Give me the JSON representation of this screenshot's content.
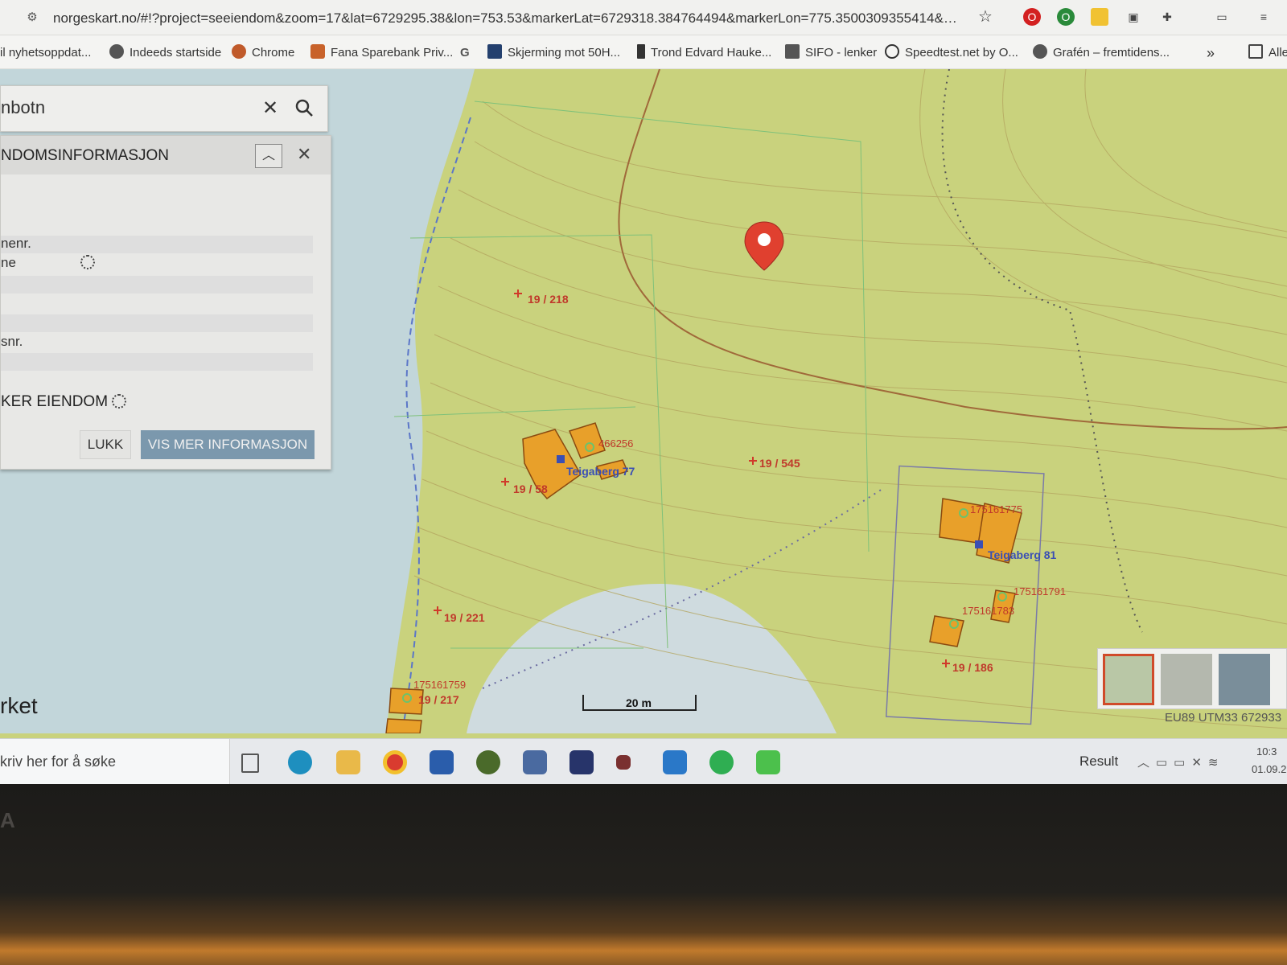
{
  "browser": {
    "url": "norgeskart.no/#!?project=seeiendom&zoom=17&lat=6729295.38&lon=753.53&markerLat=6729318.384764494&markerLon=775.3500309355414&pa...",
    "bookmarks": [
      "il nyhetsoppdat...",
      "Indeeds startside",
      "Chrome",
      "Fana Sparebank Priv...",
      "G",
      "Skjerming mot 50H...",
      "Trond Edvard Hauke...",
      "SIFO - lenker",
      "Speedtest.net by O...",
      "Grafén – fremtidens...",
      "»",
      "Alle"
    ]
  },
  "search": {
    "value": "nbotn"
  },
  "info_panel": {
    "title": "NDOMSINFORMASJON",
    "fields": [
      "nenr.",
      "ne",
      "snr."
    ],
    "loader_label": "KER EIENDOM",
    "close_label": "LUKK",
    "more_info_label": "VIS MER INFORMASJON"
  },
  "map": {
    "parcels": [
      "19 / 218",
      "19 / 545",
      "19 / 58",
      "19 / 221",
      "19 / 186",
      "19 / 217"
    ],
    "buildings": [
      "175161775",
      "175161791",
      "175161783",
      "175161759",
      "466256"
    ],
    "addresses": [
      "Teigaberg 77",
      "Teigaberg 81"
    ],
    "scale": "20 m",
    "corner_label": "rket",
    "projection": "EU89 UTM33 672933",
    "land_color": "#c9d27d",
    "water_color": "#c2d6da",
    "building_color": "#e8a02a",
    "marker_color": "#e0402f"
  },
  "taskbar": {
    "search_placeholder": "kriv her for å søke",
    "tray_label": "Result",
    "clock_time": "10:3",
    "clock_date": "01.09.2"
  },
  "laptop": {
    "brand": "A"
  }
}
